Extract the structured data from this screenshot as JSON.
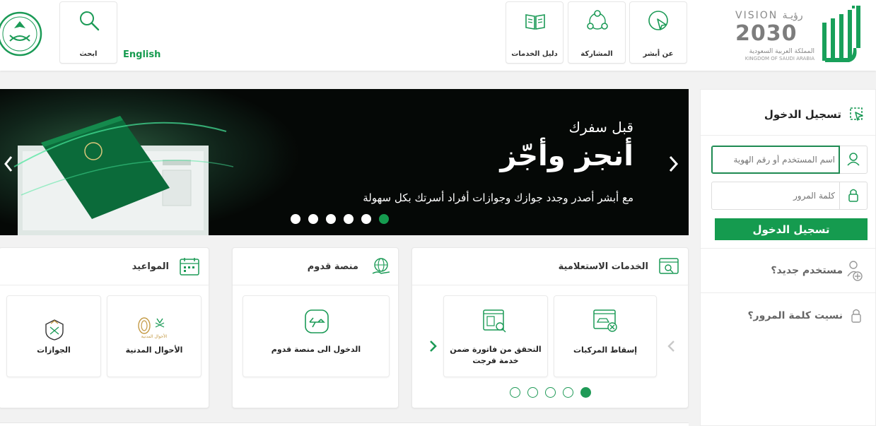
{
  "header": {
    "vision": {
      "top": "VISION رؤيـة",
      "year": "2030",
      "arabic": "المملكة العربية السعودية",
      "english": "KINGDOM OF SAUDI ARABIA"
    },
    "nav": [
      {
        "label": "عن أبشر",
        "icon": "pointer-click-icon"
      },
      {
        "label": "المشاركة",
        "icon": "participation-icon"
      },
      {
        "label": "دليل الخدمات",
        "icon": "book-icon"
      }
    ],
    "search_label": "ابحث",
    "language": "English"
  },
  "banner": {
    "line1": "قبل سفرك",
    "line2": "أنجز وأجّز",
    "line3": "مع أبشر أصدر وجدد جوازك وجوازات أفراد أسرتك بكل سهولة",
    "slides": 6,
    "active_slide": 1
  },
  "login": {
    "title": "تسجيل الدخول",
    "username_placeholder": "اسم المستخدم أو رقم الهوية",
    "password_placeholder": "كلمة المرور",
    "button": "تسجيل الدخول",
    "new_user": "مستخدم جديد؟",
    "forgot_password": "نسيت كلمة المرور؟"
  },
  "cards": {
    "inquiry": {
      "title": "الخدمات الاستعلامية",
      "tiles": [
        "إسقاط المركبات",
        "التحقق من فاتورة ضمن خدمة فرجت"
      ],
      "pages": 5,
      "active_page": 1
    },
    "arrival": {
      "title": "منصة قدوم",
      "tiles": [
        "الدخول الى منصة قدوم"
      ]
    },
    "appointments": {
      "title": "المواعيد",
      "tiles": [
        "الأحوال المدنية",
        "الجوازات"
      ],
      "civil_logo_text": "الأحوال المدنية"
    }
  },
  "colors": {
    "brand_green": "#159b4f",
    "dark_banner": "#050806"
  }
}
